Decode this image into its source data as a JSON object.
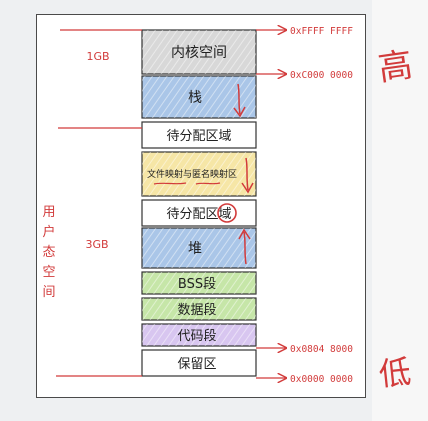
{
  "segments": [
    {
      "key": "kernel",
      "label": "内核空间",
      "color": "#d8d8d8"
    },
    {
      "key": "stack",
      "label": "栈",
      "color": "#aac6e8"
    },
    {
      "key": "unalloc1",
      "label": "待分配区域",
      "color": "#ffffff"
    },
    {
      "key": "mmap",
      "label": "文件映射与匿名映射区",
      "color": "#f6e6a6"
    },
    {
      "key": "unalloc2",
      "label": "待分配区域",
      "color": "#ffffff"
    },
    {
      "key": "heap",
      "label": "堆",
      "color": "#aac6e8"
    },
    {
      "key": "bss",
      "label": "BSS段",
      "color": "#c6e6a8"
    },
    {
      "key": "data",
      "label": "数据段",
      "color": "#c6e6a8"
    },
    {
      "key": "code",
      "label": "代码段",
      "color": "#d8c6f0"
    },
    {
      "key": "reserved",
      "label": "保留区",
      "color": "#ffffff"
    }
  ],
  "addresses": {
    "top": "0xFFFF FFFF",
    "kernel_start": "0xC000 0000",
    "code_start": "0x0804 8000",
    "bottom": "0x0000 0000"
  },
  "side_labels": {
    "kernel_size": "1GB",
    "user_size": "3GB",
    "user_space_chars": [
      "用",
      "户",
      "态",
      "空",
      "间"
    ]
  },
  "annotations": {
    "high": "高",
    "low": "低"
  },
  "colors": {
    "ink": "#d23b3b",
    "outline": "#333333"
  }
}
